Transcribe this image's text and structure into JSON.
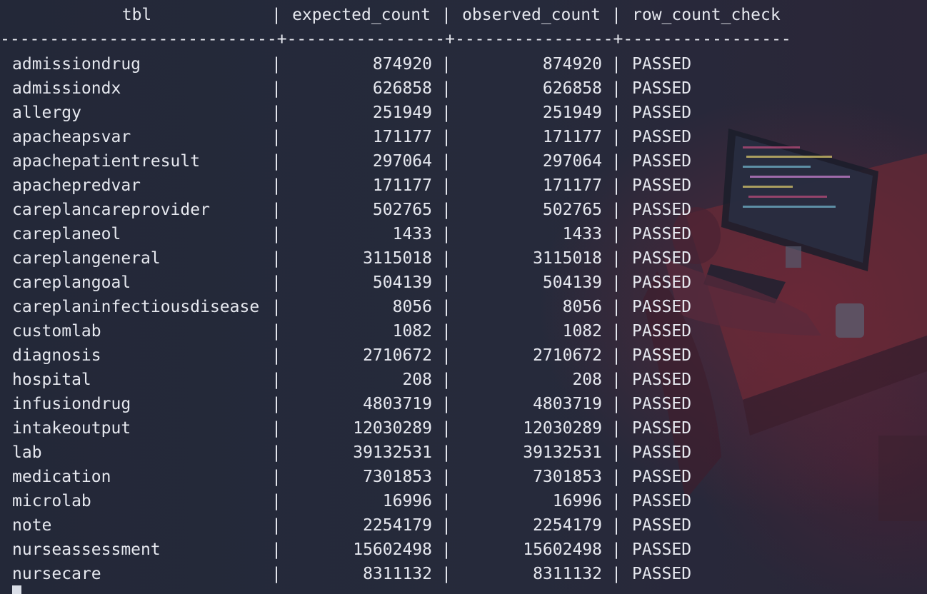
{
  "table": {
    "headers": {
      "tbl": "tbl",
      "expected_count": "expected_count",
      "observed_count": "observed_count",
      "row_count_check": "row_count_check"
    },
    "divider": "----------------------------+----------------+----------------+-----------------",
    "separator": "|",
    "rows": [
      {
        "tbl": "admissiondrug",
        "expected": "874920",
        "observed": "874920",
        "check": "PASSED"
      },
      {
        "tbl": "admissiondx",
        "expected": "626858",
        "observed": "626858",
        "check": "PASSED"
      },
      {
        "tbl": "allergy",
        "expected": "251949",
        "observed": "251949",
        "check": "PASSED"
      },
      {
        "tbl": "apacheapsvar",
        "expected": "171177",
        "observed": "171177",
        "check": "PASSED"
      },
      {
        "tbl": "apachepatientresult",
        "expected": "297064",
        "observed": "297064",
        "check": "PASSED"
      },
      {
        "tbl": "apachepredvar",
        "expected": "171177",
        "observed": "171177",
        "check": "PASSED"
      },
      {
        "tbl": "careplancareprovider",
        "expected": "502765",
        "observed": "502765",
        "check": "PASSED"
      },
      {
        "tbl": "careplaneol",
        "expected": "1433",
        "observed": "1433",
        "check": "PASSED"
      },
      {
        "tbl": "careplangeneral",
        "expected": "3115018",
        "observed": "3115018",
        "check": "PASSED"
      },
      {
        "tbl": "careplangoal",
        "expected": "504139",
        "observed": "504139",
        "check": "PASSED"
      },
      {
        "tbl": "careplaninfectiousdisease",
        "expected": "8056",
        "observed": "8056",
        "check": "PASSED"
      },
      {
        "tbl": "customlab",
        "expected": "1082",
        "observed": "1082",
        "check": "PASSED"
      },
      {
        "tbl": "diagnosis",
        "expected": "2710672",
        "observed": "2710672",
        "check": "PASSED"
      },
      {
        "tbl": "hospital",
        "expected": "208",
        "observed": "208",
        "check": "PASSED"
      },
      {
        "tbl": "infusiondrug",
        "expected": "4803719",
        "observed": "4803719",
        "check": "PASSED"
      },
      {
        "tbl": "intakeoutput",
        "expected": "12030289",
        "observed": "12030289",
        "check": "PASSED"
      },
      {
        "tbl": "lab",
        "expected": "39132531",
        "observed": "39132531",
        "check": "PASSED"
      },
      {
        "tbl": "medication",
        "expected": "7301853",
        "observed": "7301853",
        "check": "PASSED"
      },
      {
        "tbl": "microlab",
        "expected": "16996",
        "observed": "16996",
        "check": "PASSED"
      },
      {
        "tbl": "note",
        "expected": "2254179",
        "observed": "2254179",
        "check": "PASSED"
      },
      {
        "tbl": "nurseassessment",
        "expected": "15602498",
        "observed": "15602498",
        "check": "PASSED"
      },
      {
        "tbl": "nursecare",
        "expected": "8311132",
        "observed": "8311132",
        "check": "PASSED"
      }
    ]
  },
  "colors": {
    "background": "#232838",
    "text": "#e6e8ef",
    "accent_glow": "#7a2a3c"
  },
  "icons": {
    "cursor": "block-cursor-icon",
    "wallpaper": "hacker-desk-illustration"
  }
}
